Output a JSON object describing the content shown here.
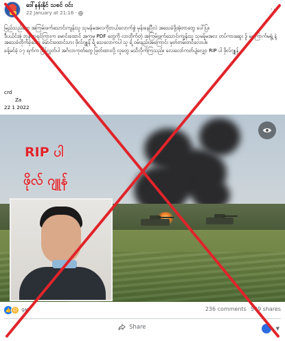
{
  "post": {
    "page_name": "ဒေါ်နန်းနိုင် သစင် ဝင်း",
    "timestamp": "22 January at 21:16 ·",
    "more_label": "...",
    "paragraphs": [
      "မြည်သည်တွေ အကြမ်းဖက်သောင်းကျန်းသူ သုမန်မအလကိုဘယ်လောက်စွဲ မုန်းနေပြီလဲ အသေခံဖို့အဲ့တာတွေ ပေါ်ပြ။",
      "ဒီပယ်င်အဲ့ ဘုန်းဘုရင်ကြားက မောင်းထောင် အကုမ္ပ PDF တွေကို လာတိုက်တဲ့ အကြမ်းဖက်သောင်းကျန်းသူ သုမန်မအလ တပ်ကားဆွေး ဒွ် မကြောက်မရွံ့ နဲ့ အသေခံတိုက်ခဲ့သော မောင်းထောင်သား ဖိုလ်ဂျူန် ရဲ့ သေလောကပါ သူ ရဲ့ ဝမ်းနည်းအကြောင်း မှတ်တမ်းတင်လေးပါ။",
      "ခန့်မင်ခဲ့ ၁၇ ရက်က ပြန်လွှတ်ပါ အင်္ဂလာကုတ်တွေ ဖြတ်ထားလို့ လူတွေ မသိလိုက်ကြသည်။ လေးလော်ကတ်ပျံလျှော RIP ပါ ဖိုလ်ဂျူန်"
    ],
    "credit_label": "crd",
    "credit_name": "Za",
    "credit_date": "22 1 2022"
  },
  "media": {
    "overlay_title": "RIP ပါ",
    "overlay_name": "ဖိုလ် ဂျူန်"
  },
  "footer": {
    "reaction_count": "9K",
    "comments": "236 comments",
    "shares": "549 shares",
    "share_label": "Share"
  },
  "colors": {
    "false_cross": "#e0242a",
    "link_blue": "#1877f2"
  }
}
